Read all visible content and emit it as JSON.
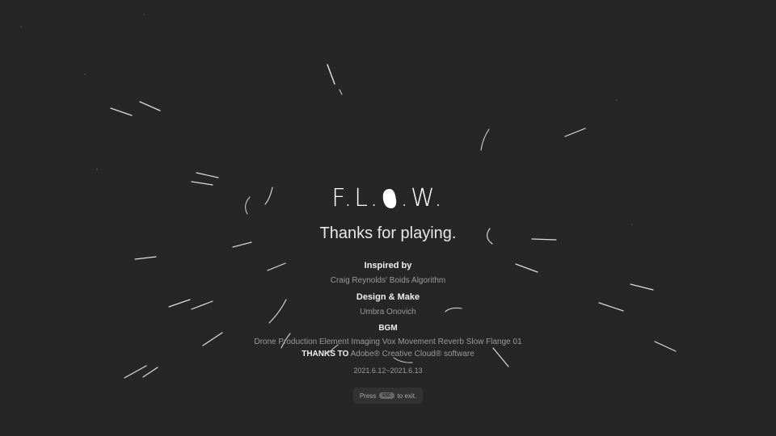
{
  "game": {
    "title_left": "F.L.",
    "title_right": ".W.",
    "subtitle": "Thanks for playing."
  },
  "credits": {
    "inspired_heading": "Inspired by",
    "inspired_value": "Craig Reynolds' Boids Algorithm",
    "design_heading": "Design & Make",
    "design_value": "Umbra Onovich",
    "bgm_heading": "BGM",
    "bgm_value": "Drone Production Element Imaging Vox Movement Reverb Slow Flange 01",
    "thanks_heading": "THANKS TO",
    "thanks_value": "Adobe® Creative Cloud® software",
    "dates": "2021.6.12~2021.6.13"
  },
  "exit_hint": {
    "before": "Press",
    "key": "ESC",
    "after": "to exit."
  },
  "colors": {
    "background": "#262626",
    "streak": "#ffffff",
    "text_primary": "#f0f0f0",
    "text_secondary": "#9a9a9a"
  }
}
